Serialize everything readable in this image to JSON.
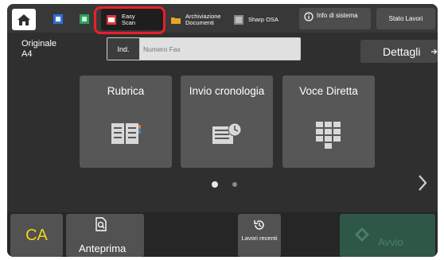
{
  "topbar": {
    "home_icon": "home-icon",
    "easy_scan_label": "Easy\nScan",
    "archiviazione_label": "Archiviazione\nDocumenti",
    "sharp_osa_label": "Sharp OSA",
    "info_label": "Info di sistema",
    "stato_lavori_label": "Stato Lavori"
  },
  "original": {
    "label": "Originale",
    "size": "A4"
  },
  "address": {
    "ind_label": "Ind.",
    "fax_placeholder": "Numero Fax"
  },
  "dettagli_label": "Dettagli",
  "tiles": [
    {
      "label": "Rubrica",
      "icon": "address-book-icon"
    },
    {
      "label": "Invio cronologia",
      "icon": "history-list-icon"
    },
    {
      "label": "Voce Diretta",
      "icon": "keypad-icon"
    }
  ],
  "pagination": {
    "current": 1,
    "total": 2
  },
  "bottom": {
    "ca_label": "CA",
    "anteprima_label": "Anteprima",
    "lavori_recenti_label": "Lavori recenti",
    "avvio_label": "Avvio"
  },
  "colors": {
    "highlight": "#e8202b",
    "ca_text": "#f3d21a",
    "avvio_bg": "#2f5748"
  }
}
